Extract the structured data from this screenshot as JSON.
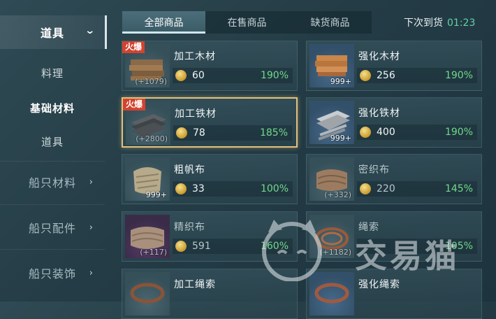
{
  "sidebar": {
    "items": [
      {
        "label": "道具"
      },
      {
        "label": "料理"
      },
      {
        "label": "基础材料"
      },
      {
        "label": "道具"
      },
      {
        "label": "船只材料"
      },
      {
        "label": "船只配件"
      },
      {
        "label": "船只装饰"
      }
    ]
  },
  "tabs": [
    {
      "label": "全部商品"
    },
    {
      "label": "在售商品"
    },
    {
      "label": "缺货商品"
    }
  ],
  "restock": {
    "label": "下次到货",
    "time": "01:23"
  },
  "hot_label": "火爆",
  "items": [
    {
      "name": "加工木材",
      "price": "60",
      "pct": "190%",
      "count": "(+1079)"
    },
    {
      "name": "强化木材",
      "price": "256",
      "pct": "190%",
      "count": "999+"
    },
    {
      "name": "加工铁材",
      "price": "78",
      "pct": "185%",
      "count": "(+2800)"
    },
    {
      "name": "强化铁材",
      "price": "400",
      "pct": "190%",
      "count": "999+"
    },
    {
      "name": "粗帆布",
      "price": "33",
      "pct": "100%",
      "count": "999+"
    },
    {
      "name": "密织布",
      "price": "220",
      "pct": "145%",
      "count": "(+332)"
    },
    {
      "name": "精织布",
      "price": "591",
      "pct": "160%",
      "count": "(+117)"
    },
    {
      "name": "绳索",
      "price": "",
      "pct": "105%",
      "count": "(+1182)"
    },
    {
      "name": "加工绳索",
      "price": "",
      "pct": "",
      "count": ""
    },
    {
      "name": "强化绳索",
      "price": "",
      "pct": "",
      "count": ""
    }
  ],
  "watermark": {
    "text": "交易猫"
  },
  "colors": {
    "accent_green": "#72d98c",
    "hot_red": "#d2432f",
    "selected_border": "#e2c27a",
    "time_green": "#63d1a6"
  }
}
